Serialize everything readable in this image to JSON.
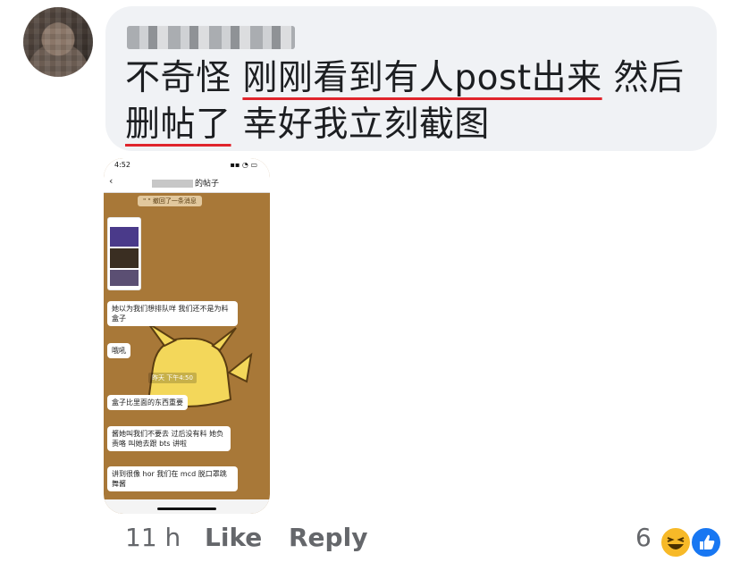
{
  "comment": {
    "line1_plain": "不奇怪 ",
    "line1_underlined": "刚刚看到有人post出来",
    "line1_tail": " 然后",
    "line2_underlined": "删帖了",
    "line2_tail": " 幸好我立刻截图"
  },
  "screenshot": {
    "status_time": "4:52",
    "status_icons": "▪▪ ◔ ▭",
    "back_glyph": "‹",
    "nav_title_suffix": "的帖子",
    "recall_notice": "\"   \" 撤回了一条消息",
    "timestamp": "昨天 下午4:50",
    "messages": [
      "她以为我们想排队咩 我们还不是为料盒子",
      "哦吼",
      "盒子比里面的东西重要",
      "酱她叫我们不要去 过后没有料 她负责咯 叫她去跟 bts 讲啦",
      "讲到很像 hor 我们在 mcd 脱口罩跳舞酱"
    ]
  },
  "footer": {
    "time": "11 h",
    "like": "Like",
    "reply": "Reply",
    "reaction_count": "6"
  },
  "reactions": [
    "haha-icon",
    "like-icon"
  ],
  "colors": {
    "bubble": "#f0f2f5",
    "underline": "#e0242c",
    "chat_bg": "#a87838",
    "meta_text": "#65676b",
    "like_blue": "#1877f2",
    "haha_yellow": "#f7b928"
  }
}
